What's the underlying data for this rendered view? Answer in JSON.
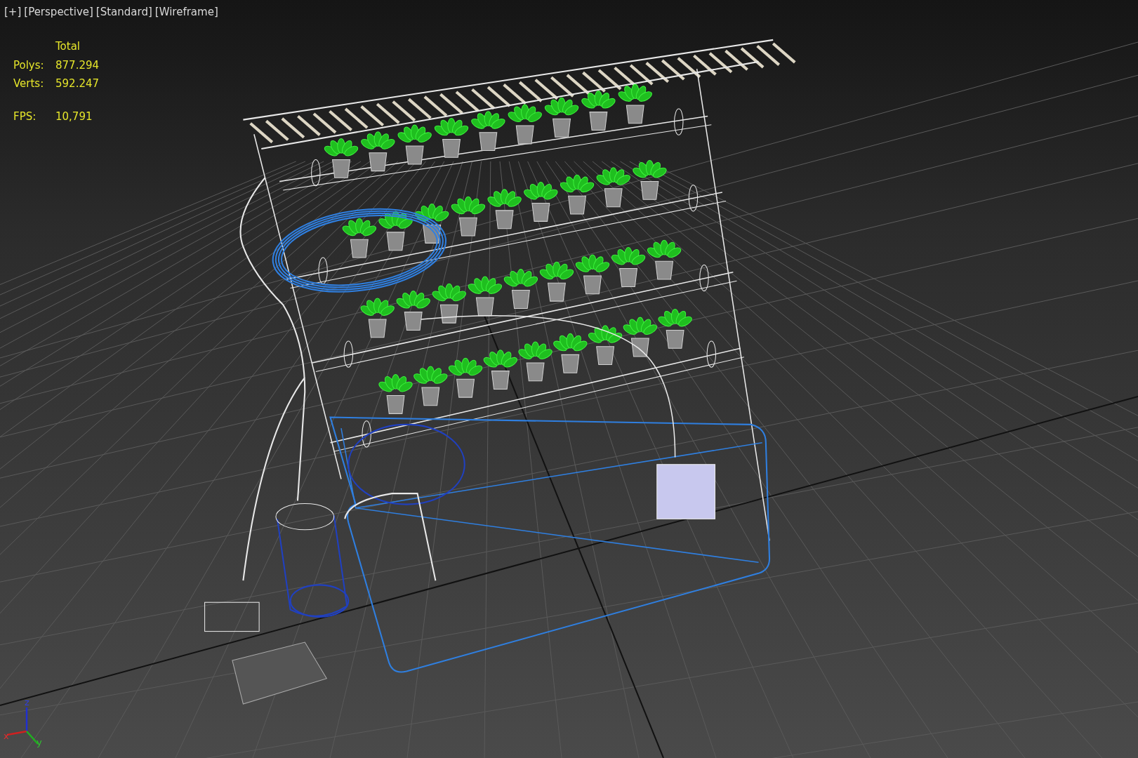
{
  "viewport_labels": [
    "[+]",
    "[Perspective]",
    "[Standard]",
    "[Wireframe]"
  ],
  "stats": {
    "header": "Total",
    "rows": [
      {
        "label": "Polys:",
        "value": "877.294"
      },
      {
        "label": "Verts:",
        "value": "592.247"
      },
      {
        "label": "FPS:",
        "value": "10,791"
      }
    ]
  },
  "axis_labels": {
    "x": "x",
    "y": "y",
    "z": "z"
  }
}
